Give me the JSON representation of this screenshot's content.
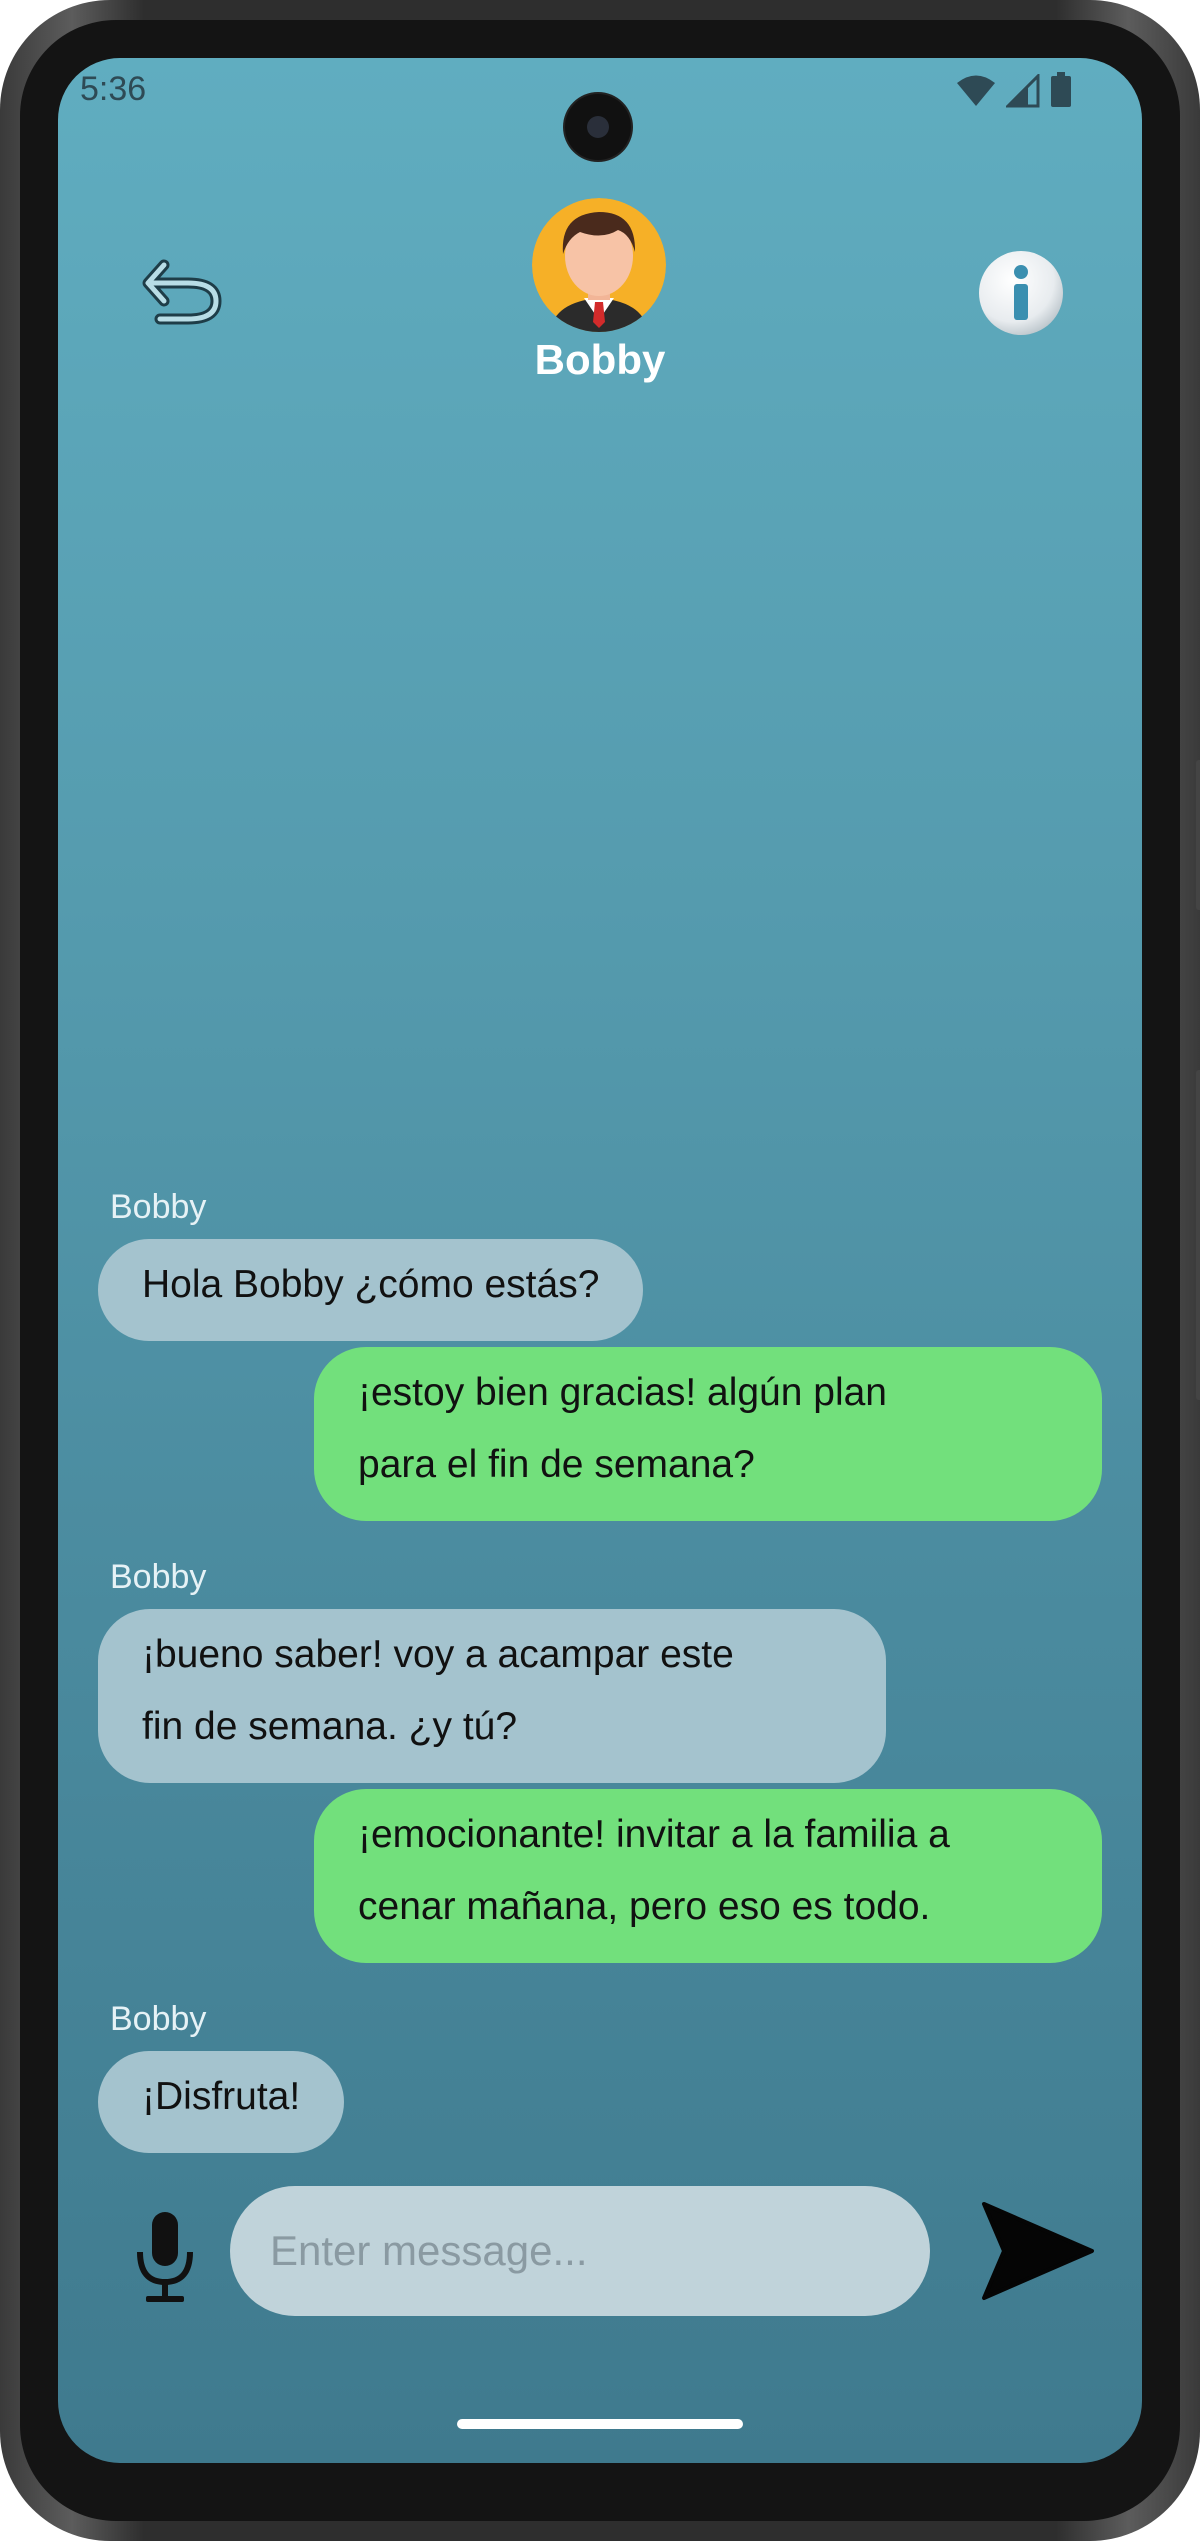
{
  "status_bar": {
    "time": "5:36"
  },
  "header": {
    "contact_name": "Bobby",
    "back_icon": "back-arrow-icon",
    "info_icon": "info-icon"
  },
  "messages": [
    {
      "direction": "in",
      "sender": "Bobby",
      "lines": [
        "Hola Bobby ¿cómo estás?"
      ]
    },
    {
      "direction": "out",
      "lines": [
        "¡estoy bien gracias! algún plan",
        "para el fin de semana?"
      ]
    },
    {
      "direction": "in",
      "sender": "Bobby",
      "lines": [
        "¡bueno saber! voy a acampar este",
        "fin de semana. ¿y tú?"
      ]
    },
    {
      "direction": "out",
      "lines": [
        "¡emocionante! invitar a la familia a",
        "cenar mañana, pero eso es todo."
      ]
    },
    {
      "direction": "in",
      "sender": "Bobby",
      "lines": [
        "¡Disfruta!"
      ]
    }
  ],
  "composer": {
    "placeholder": "Enter message...",
    "mic_icon": "microphone-icon",
    "send_icon": "send-icon"
  },
  "colors": {
    "incoming_bubble": "#a4c3ce",
    "outgoing_bubble": "#72e07c",
    "background_top": "#60adc0",
    "background_bottom": "#3f7a8e"
  }
}
